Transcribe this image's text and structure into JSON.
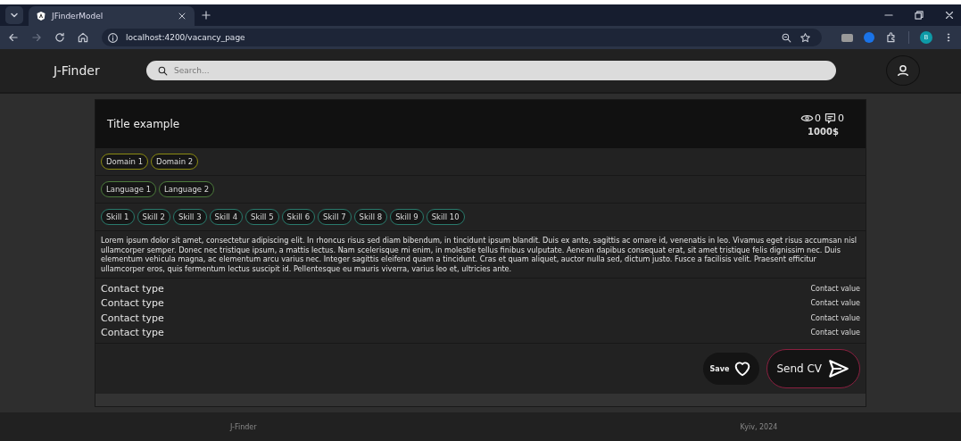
{
  "browser": {
    "tabs": [
      {
        "title": "JFinderModel",
        "selected": true
      }
    ],
    "address": "localhost:4200/vacancy_page",
    "profile": "B"
  },
  "header": {
    "logo": "J-Finder",
    "search": {
      "placeholder": "Search..."
    }
  },
  "vacancy": {
    "title": "Title example",
    "views": "0",
    "comments": "0",
    "salary": "1000$",
    "tag_rows": [
      {
        "kind": "domain",
        "tags": [
          "Domain 1",
          "Domain 2"
        ]
      },
      {
        "kind": "language",
        "tags": [
          "Language 1",
          "Language 2"
        ]
      },
      {
        "kind": "skill",
        "tags": [
          "Skill 1",
          "Skill 2",
          "Skill 3",
          "Skill 4",
          "Skill 5",
          "Skill 6",
          "Skill 7",
          "Skill 8",
          "Skill 9",
          "Skill 10"
        ]
      }
    ],
    "description": "Lorem ipsum dolor sit amet, consectetur adipiscing elit. In rhoncus risus sed diam bibendum, in tincidunt ipsum blandit. Duis ex ante, sagittis ac ornare id, venenatis in leo. Vivamus eget risus accumsan nisl ullamcorper semper. Donec nec tristique ipsum, a mattis lectus. Nam scelerisque mi enim, in molestie tellus finibus vulputate. Aenean dapibus consequat erat, sit amet tristique felis dignissim nec. Duis elementum vehicula magna, ac elementum arcu varius nec. Integer sagittis eleifend quam a tincidunt. Cras et quam aliquet, auctor nulla sed, dictum justo. Fusce a facilisis velit. Praesent efficitur ullamcorper eros, quis fermentum lectus suscipit id. Pellentesque eu mauris viverra, varius leo et, ultricies ante.",
    "contacts": [
      {
        "type": "Contact type",
        "value": "Contact value"
      },
      {
        "type": "Contact type",
        "value": "Contact value"
      },
      {
        "type": "Contact type",
        "value": "Contact value"
      },
      {
        "type": "Contact type",
        "value": "Contact value"
      }
    ],
    "save_label": "Save",
    "send_label": "Send CV"
  },
  "footer": {
    "left": "J-Finder",
    "right": "Kyiv, 2024"
  }
}
